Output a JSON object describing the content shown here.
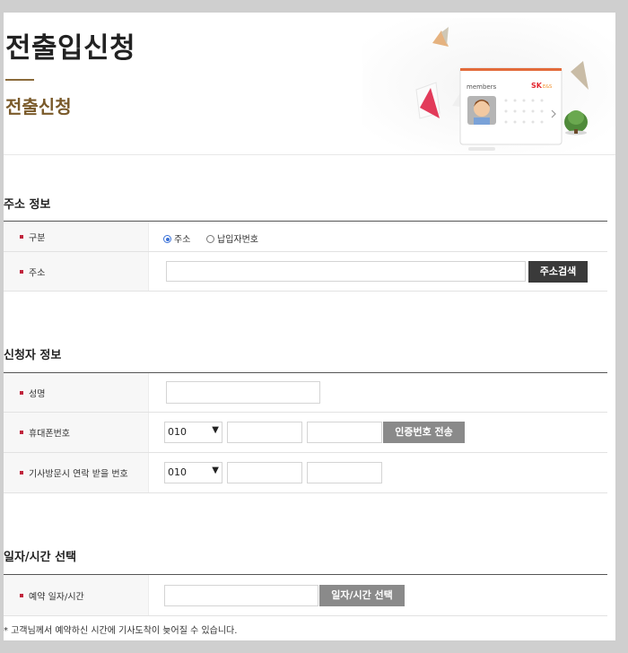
{
  "page": {
    "title": "전출입신청",
    "subtitle": "전출신청"
  },
  "hero": {
    "card_label": "members",
    "brand": "SK",
    "brand_sub": "E&S"
  },
  "colors": {
    "accent_brown": "#7a5a2a",
    "marker_red": "#c0243c",
    "dark_button": "#3a3a3a",
    "gray_button": "#8a8a8a",
    "radio_blue": "#3b72d8"
  },
  "address_section": {
    "title": "주소 정보",
    "type_label": "구분",
    "type_options": [
      {
        "label": "주소",
        "selected": true
      },
      {
        "label": "납입자번호",
        "selected": false
      }
    ],
    "address_label": "주소",
    "address_value": "",
    "search_button": "주소검색"
  },
  "applicant_section": {
    "title": "신청자 정보",
    "name_label": "성명",
    "name_value": "",
    "mobile_label": "휴대폰번호",
    "mobile_prefix": "010",
    "mobile_mid": "",
    "mobile_last": "",
    "send_code_button": "인증번호 전송",
    "visit_contact_label": "기사방문시 연락 받을 번호",
    "visit_prefix": "010",
    "visit_mid": "",
    "visit_last": ""
  },
  "schedule_section": {
    "title": "일자/시간 선택",
    "reserve_label": "예약 일자/시간",
    "reserve_value": "",
    "select_button": "일자/시간 선택"
  },
  "notice": "* 고객님께서 예약하신 시간에 기사도착이 늦어질 수 있습니다."
}
